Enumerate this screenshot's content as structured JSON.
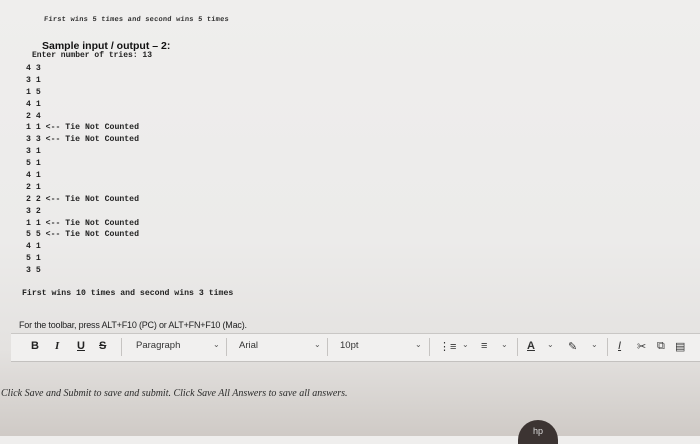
{
  "top_partial_line": "First wins 5 times and second wins 5 times",
  "sample": {
    "heading": "Sample input / output – 2:",
    "prompt": "Enter number of tries: 13",
    "lines": [
      "4 3",
      "3 1",
      "1 5",
      "4 1",
      "2 4",
      "1 1 <-- Tie Not Counted",
      "3 3 <-- Tie Not Counted",
      "3 1",
      "5 1",
      "4 1",
      "2 1",
      "2 2 <-- Tie Not Counted",
      "3 2",
      "1 1 <-- Tie Not Counted",
      "5 5 <-- Tie Not Counted",
      "4 1",
      "5 1",
      "3 5"
    ],
    "result": "First wins 10 times and second wins 3 times"
  },
  "editor": {
    "toolbar_hint": "For the toolbar, press ALT+F10 (PC) or ALT+FN+F10 (Mac).",
    "bold": "B",
    "italic": "I",
    "underline": "U",
    "strike": "S",
    "paragraph": "Paragraph",
    "font": "Arial",
    "size": "10pt"
  },
  "instructions": "Click Save and Submit to save and submit. Click Save All Answers to save all answers.",
  "logo_text": "hp"
}
